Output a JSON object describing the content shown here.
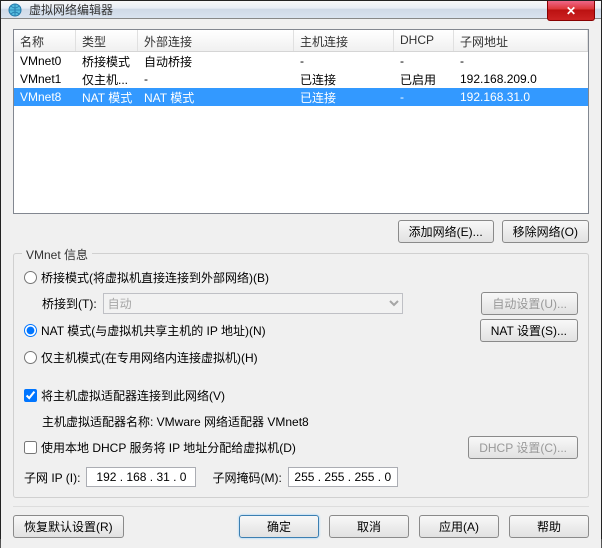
{
  "window": {
    "title": "虚拟网络编辑器",
    "close": "✕"
  },
  "table": {
    "headers": [
      "名称",
      "类型",
      "外部连接",
      "主机连接",
      "DHCP",
      "子网地址"
    ],
    "rows": [
      {
        "name": "VMnet0",
        "type": "桥接模式",
        "ext": "自动桥接",
        "host": "-",
        "dhcp": "-",
        "sub": "-",
        "selected": false
      },
      {
        "name": "VMnet1",
        "type": "仅主机...",
        "ext": "-",
        "host": "已连接",
        "dhcp": "已启用",
        "sub": "192.168.209.0",
        "selected": false
      },
      {
        "name": "VMnet8",
        "type": "NAT 模式",
        "ext": "NAT 模式",
        "host": "已连接",
        "dhcp": "-",
        "sub": "192.168.31.0",
        "selected": true
      }
    ]
  },
  "buttons": {
    "add_net": "添加网络(E)...",
    "remove_net": "移除网络(O)"
  },
  "group": {
    "title": "VMnet 信息",
    "bridge_radio": "桥接模式(将虚拟机直接连接到外部网络)(B)",
    "bridge_to_label": "桥接到(T):",
    "bridge_to_value": "自动",
    "auto_set": "自动设置(U)...",
    "nat_radio": "NAT 模式(与虚拟机共享主机的 IP 地址)(N)",
    "nat_set": "NAT 设置(S)...",
    "hostonly_radio": "仅主机模式(在专用网络内连接虚拟机)(H)",
    "connect_adapter": "将主机虚拟适配器连接到此网络(V)",
    "adapter_name": "主机虚拟适配器名称: VMware 网络适配器 VMnet8",
    "use_dhcp": "使用本地 DHCP 服务将 IP 地址分配给虚拟机(D)",
    "dhcp_set": "DHCP 设置(C)...",
    "subnet_ip_label": "子网 IP (I):",
    "subnet_ip": "192 . 168 . 31 . 0",
    "mask_label": "子网掩码(M):",
    "mask": "255 . 255 . 255 . 0"
  },
  "bottom": {
    "restore": "恢复默认设置(R)",
    "ok": "确定",
    "cancel": "取消",
    "apply": "应用(A)",
    "help": "帮助"
  }
}
